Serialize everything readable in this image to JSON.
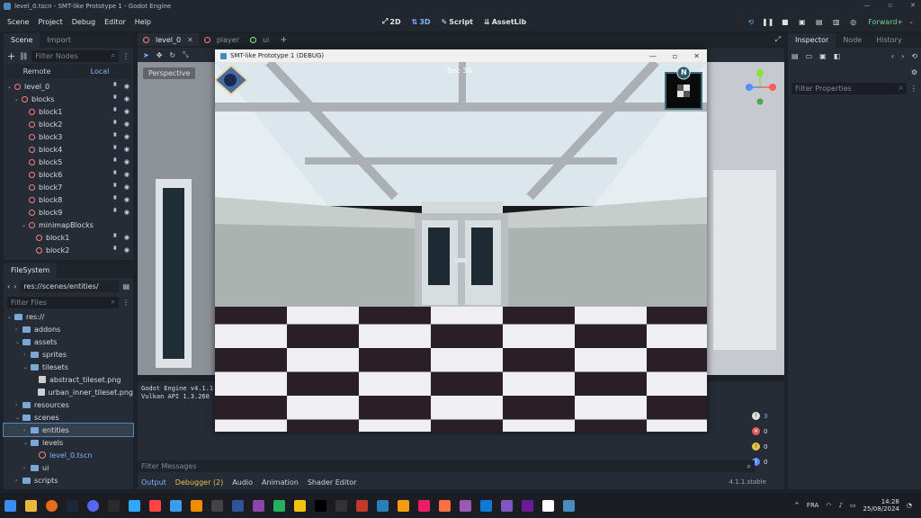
{
  "window": {
    "title": "level_0.tscn - SMT-like Prototype 1 - Godot Engine",
    "controls": [
      "—",
      "▫",
      "✕"
    ]
  },
  "menu": {
    "items": [
      "Scene",
      "Project",
      "Debug",
      "Editor",
      "Help"
    ]
  },
  "workspaces": [
    {
      "label": "2D",
      "icon": "editor-2d-icon",
      "glyph": "⤢"
    },
    {
      "label": "3D",
      "icon": "editor-3d-icon",
      "glyph": "⇅",
      "active": true
    },
    {
      "label": "Script",
      "icon": "script-icon",
      "glyph": "✎"
    },
    {
      "label": "AssetLib",
      "icon": "assetlib-icon",
      "glyph": "⇊"
    }
  ],
  "renderer": "Forward+",
  "scene_dock": {
    "tabs": [
      "Scene",
      "Import"
    ],
    "filter_placeholder": "Filter Nodes",
    "remote_label": "Remote",
    "local_label": "Local",
    "nodes": [
      {
        "label": "level_0",
        "depth": 0
      },
      {
        "label": "blocks",
        "depth": 1
      },
      {
        "label": "block1",
        "depth": 2
      },
      {
        "label": "block2",
        "depth": 2
      },
      {
        "label": "block3",
        "depth": 2
      },
      {
        "label": "block4",
        "depth": 2
      },
      {
        "label": "block5",
        "depth": 2
      },
      {
        "label": "block6",
        "depth": 2
      },
      {
        "label": "block7",
        "depth": 2
      },
      {
        "label": "block8",
        "depth": 2
      },
      {
        "label": "block9",
        "depth": 2
      },
      {
        "label": "minimapBlocks",
        "depth": 2
      },
      {
        "label": "block1",
        "depth": 3
      },
      {
        "label": "block2",
        "depth": 3
      }
    ]
  },
  "filesystem_dock": {
    "tab": "FileSystem",
    "path": "res://scenes/entities/",
    "filter_placeholder": "Filter Files",
    "entries": [
      {
        "label": "res://",
        "depth": 0,
        "kind": "folder"
      },
      {
        "label": "addons",
        "depth": 1,
        "kind": "folder"
      },
      {
        "label": "assets",
        "depth": 1,
        "kind": "folder"
      },
      {
        "label": "sprites",
        "depth": 2,
        "kind": "folder"
      },
      {
        "label": "tilesets",
        "depth": 2,
        "kind": "folder"
      },
      {
        "label": "abstract_tileset.png",
        "depth": 3,
        "kind": "image"
      },
      {
        "label": "urban_inner_tileset.png",
        "depth": 3,
        "kind": "image"
      },
      {
        "label": "resources",
        "depth": 1,
        "kind": "folder"
      },
      {
        "label": "scenes",
        "depth": 1,
        "kind": "folder"
      },
      {
        "label": "entities",
        "depth": 2,
        "kind": "folder",
        "selected": true
      },
      {
        "label": "levels",
        "depth": 2,
        "kind": "folder"
      },
      {
        "label": "level_0.tscn",
        "depth": 3,
        "kind": "scene"
      },
      {
        "label": "ui",
        "depth": 2,
        "kind": "folder"
      },
      {
        "label": "scripts",
        "depth": 1,
        "kind": "folder"
      }
    ]
  },
  "editor_tabs": [
    "level_0",
    "player",
    "ui"
  ],
  "viewport": {
    "perspective_label": "Perspective"
  },
  "game_window": {
    "title": "SMT-like Prototype 1 (DEBUG)",
    "fps": "fps: 30",
    "compass": "N"
  },
  "output": {
    "lines": [
      "Godot Engine v4.1.1",
      "Vulkan API 1.3.260"
    ],
    "filter_placeholder": "Filter Messages",
    "tabs": [
      "Output",
      "Debugger (2)",
      "Audio",
      "Animation",
      "Shader Editor"
    ],
    "version": "4.1.1.stable",
    "counts": [
      "3",
      "0",
      "0",
      "0"
    ]
  },
  "inspector": {
    "tabs": [
      "Inspector",
      "Node",
      "History"
    ],
    "filter_placeholder": "Filter Properties"
  },
  "taskbar": {
    "language": "FRA",
    "time": "14:28",
    "date": "25/08/2024"
  }
}
